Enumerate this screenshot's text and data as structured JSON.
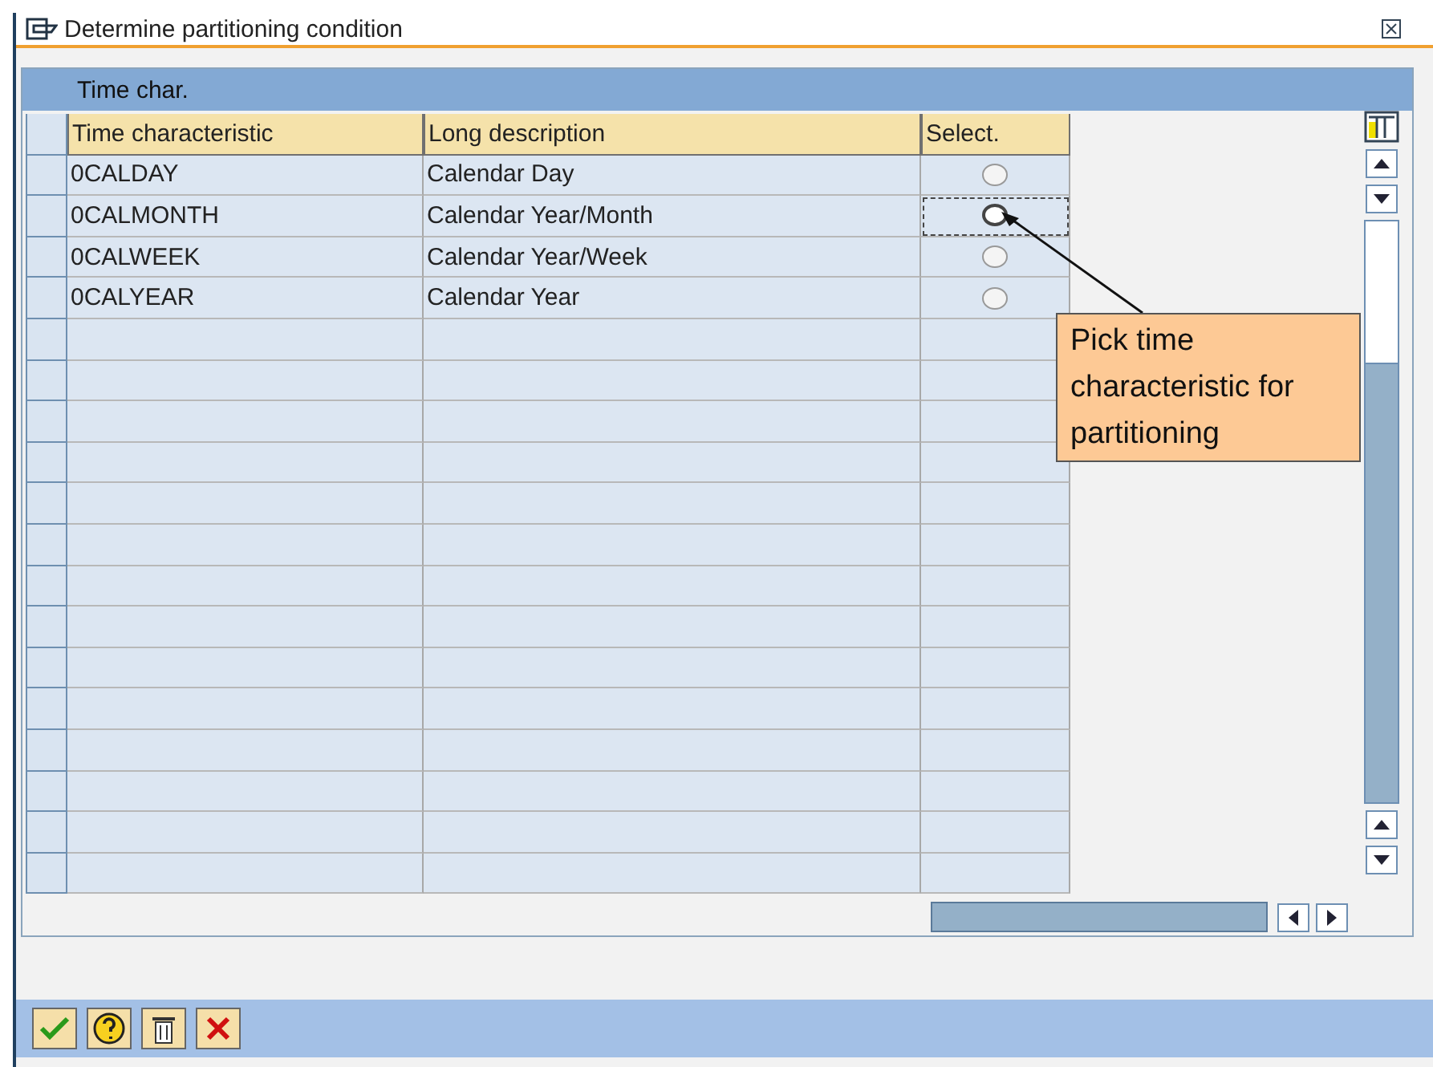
{
  "window": {
    "title": "Determine partitioning condition"
  },
  "table": {
    "title": "Time char.",
    "columns": [
      "Time characteristic",
      "Long description",
      "Select."
    ],
    "rows": [
      {
        "cells": [
          "0CALDAY",
          "Calendar Day"
        ],
        "selected": false,
        "focused": false
      },
      {
        "cells": [
          "0CALMONTH",
          "Calendar Year/Month"
        ],
        "selected": false,
        "focused": true
      },
      {
        "cells": [
          "0CALWEEK",
          "Calendar Year/Week"
        ],
        "selected": false,
        "focused": false
      },
      {
        "cells": [
          "0CALYEAR",
          "Calendar Year"
        ],
        "selected": false,
        "focused": false
      }
    ]
  },
  "callout": {
    "text": "Pick time characteristic for partitioning"
  },
  "toolbar": [
    {
      "kind": "ok"
    },
    {
      "kind": "help"
    },
    {
      "kind": "delete"
    },
    {
      "kind": "cancel"
    }
  ]
}
